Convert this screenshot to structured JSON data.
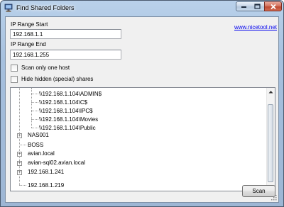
{
  "window": {
    "title": "Find Shared Folders",
    "app_icon": "network-computer-icon",
    "controls": [
      "minimize-icon",
      "maximize-icon",
      "close-icon"
    ]
  },
  "form": {
    "ip_start_label": "IP Range Start",
    "ip_start_value": "192.168.1.1",
    "ip_end_label": "IP Range End",
    "ip_end_value": "192.168.1.255",
    "scan_one_host_label": "Scan only one host",
    "scan_one_host_checked": false,
    "hide_hidden_label": "Hide hidden (special) shares",
    "hide_hidden_checked": false,
    "link_text": "www.nicetool.net"
  },
  "tree": {
    "items": [
      {
        "label": "\\\\192.168.1.104\\ADMIN$",
        "level": 2
      },
      {
        "label": "\\\\192.168.1.104\\C$",
        "level": 2
      },
      {
        "label": "\\\\192.168.1.104\\IPC$",
        "level": 2
      },
      {
        "label": "\\\\192.168.1.104\\Movies",
        "level": 2
      },
      {
        "label": "\\\\192.168.1.104\\Public",
        "level": 2
      },
      {
        "label": "NAS001",
        "level": 1,
        "expandable": true
      },
      {
        "label": "BOSS",
        "level": 1,
        "expandable": false
      },
      {
        "label": "avian.local",
        "level": 1,
        "expandable": true
      },
      {
        "label": "avian-sql02.avian.local",
        "level": 1,
        "expandable": true
      },
      {
        "label": "192.168.1.241",
        "level": 1,
        "expandable": true
      },
      {
        "label": "192.168.1.219",
        "level": 1,
        "expandable": false
      }
    ]
  },
  "buttons": {
    "scan_label": "Scan"
  },
  "colors": {
    "link": "#0000ee",
    "close_button": "#c8553d",
    "titlebar": "#a6c0de"
  }
}
